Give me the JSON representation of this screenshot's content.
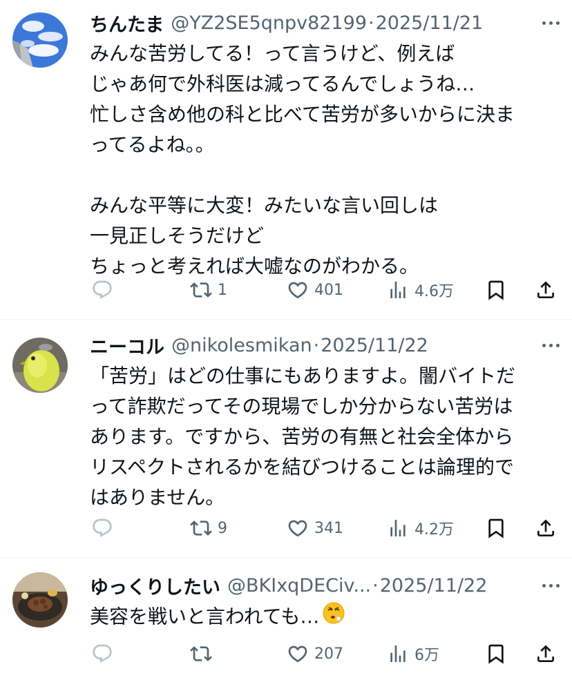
{
  "posts": [
    {
      "name": "ちんたま",
      "handle": "@YZ2SE5qnpv82199",
      "date": "2025/11/21",
      "avatar_icon": "sky-building-avatar",
      "lines": [
        "みんな苦労してる！って言うけど、例えば",
        "じゃあ何で外科医は減ってるんでしょうね…",
        "忙しさ含め他の科と比べて苦労が多いからに決ま",
        "ってるよね。。",
        "",
        "みんな平等に大変！みたいな言い回しは",
        "一見正しそうだけど",
        "ちょっと考えれば大嘘なのがわかる。"
      ],
      "replies": "",
      "retweets": "1",
      "likes": "401",
      "views": "4.6万"
    },
    {
      "name": "ニーコル",
      "handle": "@nikolesmikan",
      "date": "2025/11/22",
      "avatar_icon": "yellow-bird-avatar",
      "lines": [
        "「苦労」はどの仕事にもありますよ。闇バイトだ",
        "って詐欺だってその現場でしか分からない苦労は",
        "あります。ですから、苦労の有無と社会全体から",
        "リスペクトされるかを結びつけることは論理的で",
        "はありません。"
      ],
      "replies": "",
      "retweets": "9",
      "likes": "341",
      "views": "4.2万"
    },
    {
      "name": "ゆっくりしたい",
      "handle": "@BKIxqDECiv...",
      "date": "2025/11/22",
      "avatar_icon": "food-plate-avatar",
      "lines": [
        "美容を戦いと言われても…"
      ],
      "emoji": "tired-face-emoji",
      "replies": "",
      "retweets": "",
      "likes": "207",
      "views": "6万"
    }
  ],
  "separator": "·",
  "icons": {
    "reply": "reply-icon",
    "retweet": "retweet-icon",
    "like": "heart-icon",
    "views": "views-icon",
    "bookmark": "bookmark-icon",
    "share": "share-icon",
    "more": "more-icon"
  },
  "colors": {
    "text": "#0f1419",
    "muted": "#536471",
    "divider": "#eff3f4"
  }
}
